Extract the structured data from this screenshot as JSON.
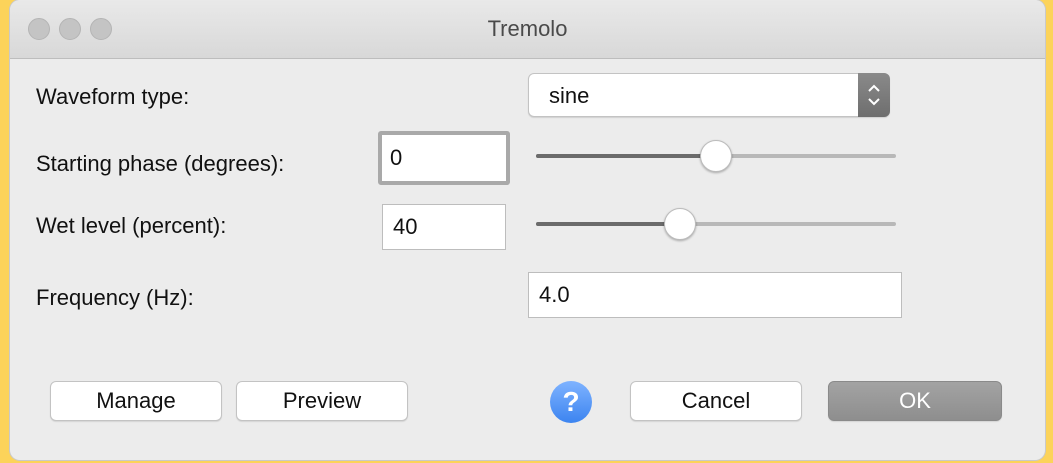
{
  "window": {
    "title": "Tremolo"
  },
  "form": {
    "waveform_label": "Waveform type:",
    "waveform_value": "sine",
    "phase_label": "Starting phase (degrees):",
    "phase_value": "0",
    "phase_slider_fraction": 0.5,
    "wet_label": "Wet level (percent):",
    "wet_value": "40",
    "wet_slider_fraction": 0.4,
    "frequency_label": "Frequency (Hz):",
    "frequency_value": "4.0"
  },
  "buttons": {
    "manage": "Manage",
    "preview": "Preview",
    "help": "?",
    "cancel": "Cancel",
    "ok": "OK"
  },
  "icons": {
    "select_arrows": "chevron-up-down-icon",
    "help": "question-icon"
  },
  "colors": {
    "background": "#fcd35a",
    "help_blue": "#4a8ef2",
    "default_button": "#999999"
  }
}
